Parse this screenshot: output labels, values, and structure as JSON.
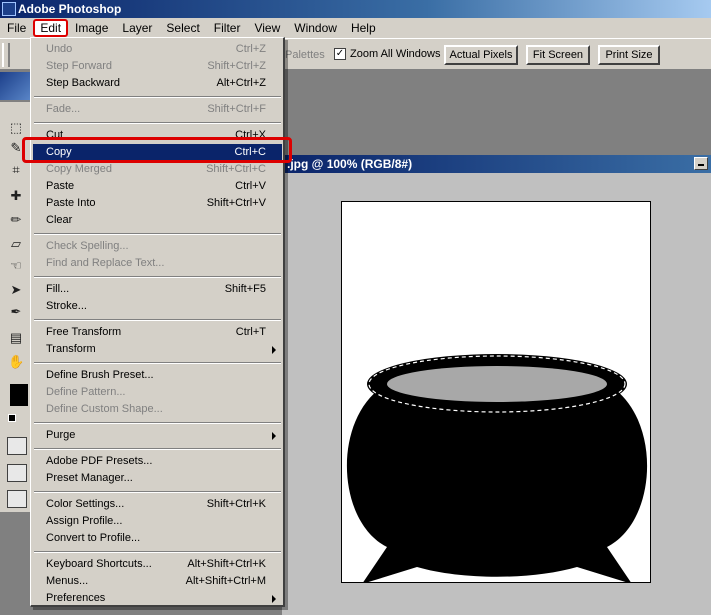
{
  "window": {
    "title": "Adobe Photoshop"
  },
  "menubar": [
    {
      "label": "File"
    },
    {
      "label": "Edit"
    },
    {
      "label": "Image"
    },
    {
      "label": "Layer"
    },
    {
      "label": "Select"
    },
    {
      "label": "Filter"
    },
    {
      "label": "View"
    },
    {
      "label": "Window"
    },
    {
      "label": "Help"
    }
  ],
  "options": {
    "palettes_label": "Palettes",
    "zoom_all_windows": {
      "label": "Zoom All Windows",
      "checked": true,
      "mark": "✓"
    },
    "actual_pixels": "Actual Pixels",
    "fit_screen": "Fit Screen",
    "print_size": "Print Size"
  },
  "document": {
    "title": ".jpg @ 100% (RGB/8#)"
  },
  "edit_menu": {
    "undo": {
      "label": "Undo",
      "shortcut": "Ctrl+Z"
    },
    "step_forward": {
      "label": "Step Forward",
      "shortcut": "Shift+Ctrl+Z"
    },
    "step_backward": {
      "label": "Step Backward",
      "shortcut": "Alt+Ctrl+Z"
    },
    "fade": {
      "label": "Fade...",
      "shortcut": "Shift+Ctrl+F"
    },
    "cut": {
      "label": "Cut",
      "shortcut": "Ctrl+X"
    },
    "copy": {
      "label": "Copy",
      "shortcut": "Ctrl+C"
    },
    "copy_merged": {
      "label": "Copy Merged",
      "shortcut": "Shift+Ctrl+C"
    },
    "paste": {
      "label": "Paste",
      "shortcut": "Ctrl+V"
    },
    "paste_into": {
      "label": "Paste Into",
      "shortcut": "Shift+Ctrl+V"
    },
    "clear": {
      "label": "Clear"
    },
    "check_spelling": {
      "label": "Check Spelling..."
    },
    "find_replace": {
      "label": "Find and Replace Text..."
    },
    "fill": {
      "label": "Fill...",
      "shortcut": "Shift+F5"
    },
    "stroke": {
      "label": "Stroke..."
    },
    "free_transform": {
      "label": "Free Transform",
      "shortcut": "Ctrl+T"
    },
    "transform": {
      "label": "Transform"
    },
    "define_brush": {
      "label": "Define Brush Preset..."
    },
    "define_pattern": {
      "label": "Define Pattern..."
    },
    "define_shape": {
      "label": "Define Custom Shape..."
    },
    "purge": {
      "label": "Purge"
    },
    "pdf_presets": {
      "label": "Adobe PDF Presets..."
    },
    "preset_manager": {
      "label": "Preset Manager..."
    },
    "color_settings": {
      "label": "Color Settings...",
      "shortcut": "Shift+Ctrl+K"
    },
    "assign_profile": {
      "label": "Assign Profile..."
    },
    "convert_profile": {
      "label": "Convert to Profile..."
    },
    "keyboard_shortcuts": {
      "label": "Keyboard Shortcuts...",
      "shortcut": "Alt+Shift+Ctrl+K"
    },
    "menus": {
      "label": "Menus...",
      "shortcut": "Alt+Shift+Ctrl+M"
    },
    "preferences": {
      "label": "Preferences"
    }
  },
  "colors": {
    "highlight": "#0a246a",
    "annotation": "#dd0000",
    "foreground": "#000000"
  }
}
